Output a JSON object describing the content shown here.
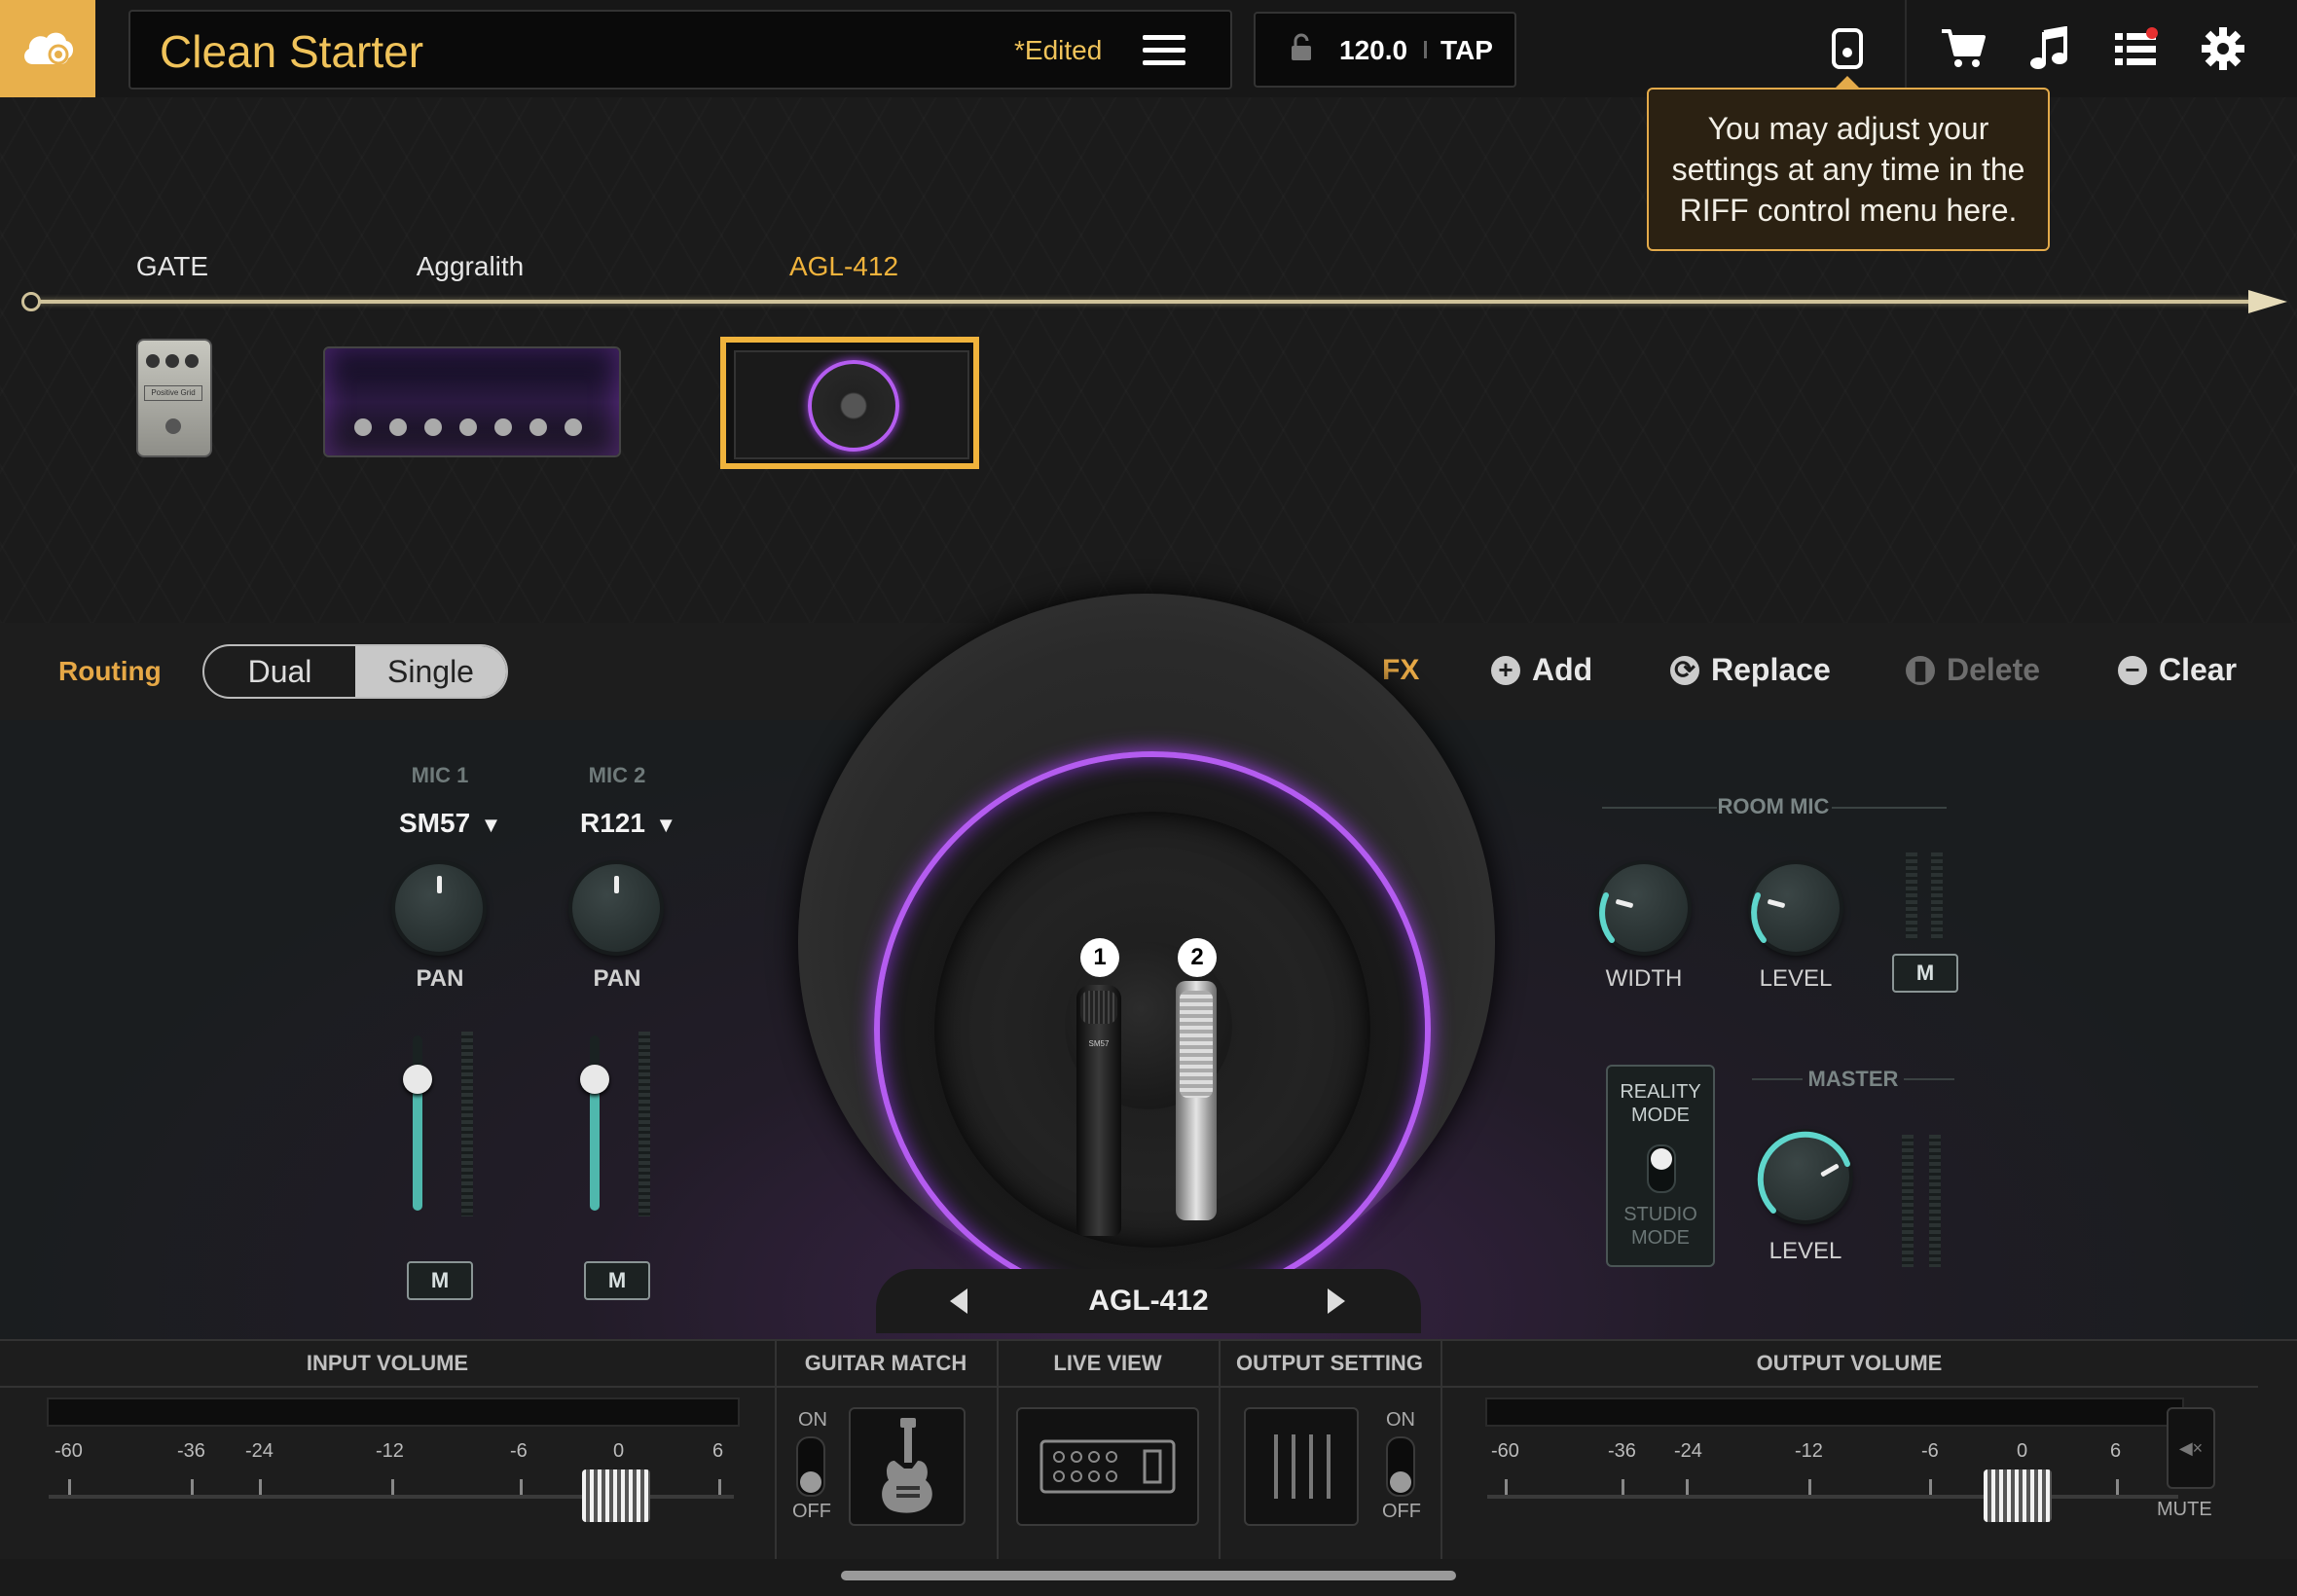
{
  "header": {
    "preset_name": "Clean Starter",
    "edited_label": "*Edited",
    "tempo": "120.0",
    "tap_label": "TAP"
  },
  "tooltip": {
    "text": "You may adjust your settings at any time in the RIFF control menu here."
  },
  "chain": {
    "items": [
      {
        "label": "GATE",
        "pedal_text": "Positive Grid"
      },
      {
        "label": "Aggralith"
      },
      {
        "label": "AGL-412"
      }
    ],
    "colors": {
      "selected": "#f0b33c",
      "accent": "#e8b04c",
      "signal": "#cfc29a"
    }
  },
  "routing": {
    "label": "Routing",
    "options": [
      "Dual",
      "Single"
    ],
    "selected": "Single",
    "fx_label": "FX",
    "actions": [
      {
        "label": "Add",
        "icon": "plus-circle-icon"
      },
      {
        "label": "Replace",
        "icon": "replace-icon"
      },
      {
        "label": "Delete",
        "icon": "trash-icon",
        "disabled": true
      },
      {
        "label": "Clear",
        "icon": "minus-circle-icon"
      }
    ]
  },
  "mics": [
    {
      "title": "MIC 1",
      "model": "SM57",
      "pan_label": "PAN",
      "mute_label": "M",
      "badge": "1",
      "body_text": "SM57"
    },
    {
      "title": "MIC 2",
      "model": "R121",
      "pan_label": "PAN",
      "mute_label": "M",
      "badge": "2"
    }
  ],
  "cab_nav": {
    "name": "AGL-412"
  },
  "room_mic": {
    "title": "ROOM MIC",
    "width_label": "WIDTH",
    "level_label": "LEVEL",
    "mute_label": "M"
  },
  "reality": {
    "top": "REALITY MODE",
    "bottom": "STUDIO MODE"
  },
  "master": {
    "title": "MASTER",
    "level_label": "LEVEL"
  },
  "bottom": {
    "input_volume": {
      "title": "INPUT VOLUME",
      "ticks": [
        "-60",
        "-36",
        "-24",
        "-12",
        "-6",
        "0",
        "6"
      ]
    },
    "guitar_match": {
      "title": "GUITAR MATCH",
      "on": "ON",
      "off": "OFF"
    },
    "live_view": {
      "title": "LIVE VIEW"
    },
    "output_setting": {
      "title": "OUTPUT SETTING",
      "on": "ON",
      "off": "OFF"
    },
    "output_volume": {
      "title": "OUTPUT VOLUME",
      "ticks": [
        "-60",
        "-36",
        "-24",
        "-12",
        "-6",
        "0",
        "6"
      ],
      "mute_label": "MUTE"
    }
  }
}
